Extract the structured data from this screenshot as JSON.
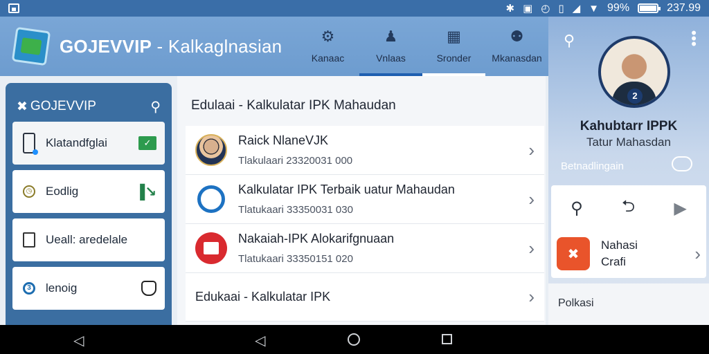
{
  "statusbar": {
    "battery_percent": "99%",
    "battery_level": 0.99,
    "time": "237.99"
  },
  "appbar": {
    "title_brand": "GOJEVVIP",
    "title_rest": " - Kalkaglnasian",
    "tabs": [
      {
        "label": "Kanaac",
        "icon": "gear-icon"
      },
      {
        "label": "Vnlaas",
        "icon": "person-icon"
      },
      {
        "label": "Sronder",
        "icon": "calculator-icon"
      },
      {
        "label": "Mkanasdan",
        "icon": "profile-icon"
      }
    ]
  },
  "drawer": {
    "title": "GOJEVVIP",
    "items": [
      {
        "label": "Klatandfglai"
      },
      {
        "label": "Eodlig"
      },
      {
        "label": "Ueall: aredelale"
      },
      {
        "label": "lenoig"
      }
    ]
  },
  "main": {
    "title": "Edulaai - Kalkulatar IPK Mahaudan",
    "rows": [
      {
        "title": "Raick NlaneVJK",
        "subtitle": "Tlakulaari 23320031 000",
        "icon": "person-photo"
      },
      {
        "title": "Kalkulatar IPK Terbaik uatur Mahaudan",
        "subtitle": "Tlatukaari 33350031 030",
        "icon": "search-ring-icon"
      },
      {
        "title": "Nakaiah-IPK Alokarifgnuaan",
        "subtitle": "Tlatukaari 33350151 020",
        "icon": "document-icon"
      }
    ],
    "footer_row": {
      "title": "Edukaai - Kalkulatar IPK"
    }
  },
  "rpanel": {
    "badge": "2",
    "name": "Kahubtarr IPPK",
    "subtitle": "Tatur Mahasdan",
    "setting_label": "Betnadlingain",
    "app_title": "Nahasi",
    "app_sub": "Crafi",
    "section_label": "Polkasi"
  },
  "colors": {
    "statusbar": "#3a6ea8",
    "appbar": "#6d9ccf",
    "drawer": "#3b6ea1",
    "accent": "#1f5fb0",
    "app_icon": "#e9542b",
    "red_icon": "#d92a2f"
  }
}
